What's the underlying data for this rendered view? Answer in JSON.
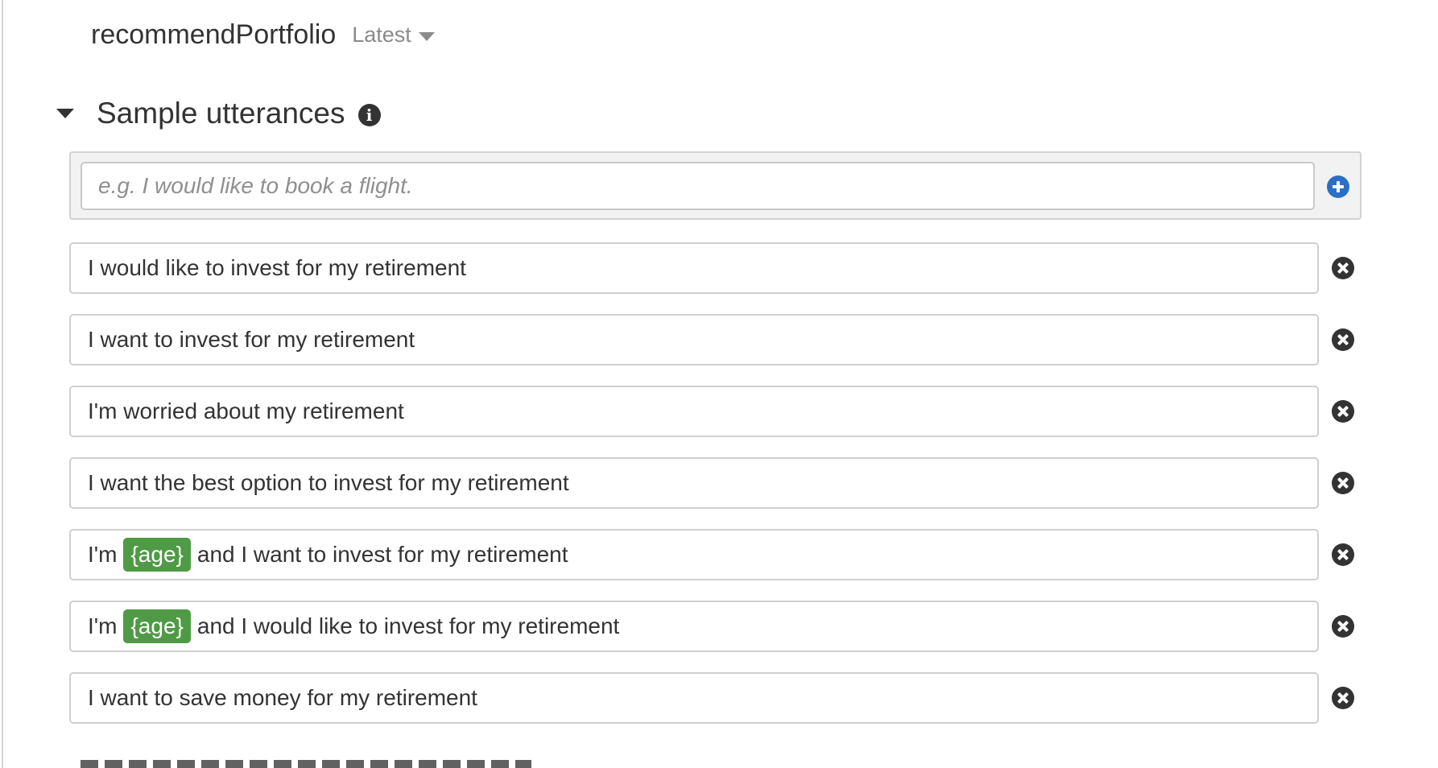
{
  "intent": {
    "name": "recommendPortfolio",
    "version": "Latest"
  },
  "sample_utterances": {
    "title": "Sample utterances",
    "input_placeholder": "e.g. I would like to book a flight.",
    "items": [
      {
        "before": "I would like to invest for my retirement",
        "slot": "",
        "after": ""
      },
      {
        "before": "I want to invest for my retirement",
        "slot": "",
        "after": ""
      },
      {
        "before": "I'm worried about my retirement",
        "slot": "",
        "after": ""
      },
      {
        "before": "I want the best option to invest for my retirement",
        "slot": "",
        "after": ""
      },
      {
        "before": "I'm",
        "slot": "{age}",
        "after": "and I want to invest for my retirement"
      },
      {
        "before": "I'm",
        "slot": "{age}",
        "after": "and I would like to invest for my retirement"
      },
      {
        "before": "I want to save money for my retirement",
        "slot": "",
        "after": ""
      }
    ]
  },
  "colors": {
    "slot_chip": "#4f9a45",
    "add_icon": "#2a6fc4",
    "remove_icon": "#333333",
    "panel_background": "#f2f2f2"
  },
  "icons": {
    "section_toggle": "caret-down-icon",
    "version_dropdown": "caret-down-icon",
    "info": "info-icon",
    "add": "plus-circle-icon",
    "remove": "close-circle-icon"
  }
}
